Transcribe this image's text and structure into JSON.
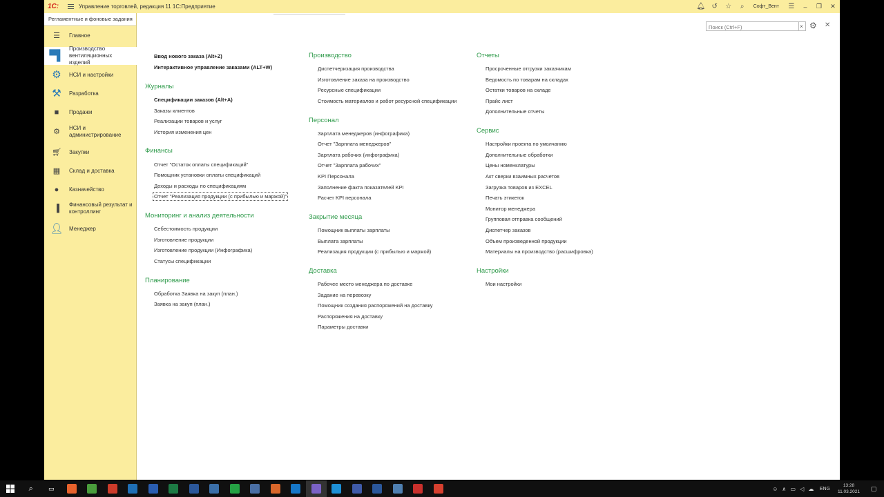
{
  "titlebar": {
    "logo": "1С:",
    "title": "Управление торговлей, редакция 11 1С:Предприятие",
    "user": "Софт_Вент"
  },
  "sidebar": {
    "bg_tasks": "Регламентные и фоновые задания",
    "items": [
      {
        "label": "Главное",
        "icon": "list-icon"
      },
      {
        "label": "Производство вентиляционных изделий",
        "icon": "factory-icon"
      },
      {
        "label": "НСИ и настройки",
        "icon": "gears-icon"
      },
      {
        "label": "Разработка",
        "icon": "development-icon"
      },
      {
        "label": "Продажи",
        "icon": "bag-icon"
      },
      {
        "label": "НСИ и администрирование",
        "icon": "gear-icon"
      },
      {
        "label": "Закупки",
        "icon": "cart-icon"
      },
      {
        "label": "Склад и доставка",
        "icon": "warehouse-icon"
      },
      {
        "label": "Казначейство",
        "icon": "coin-icon"
      },
      {
        "label": "Финансовый результат и контроллинг",
        "icon": "chart-icon"
      },
      {
        "label": "Менеджер",
        "icon": "person-icon"
      }
    ]
  },
  "search": {
    "placeholder": "Поиск (Ctrl+F)"
  },
  "col1": {
    "top_links": [
      "Ввод нового заказа (Alt+Z)",
      "Интерактивное управление заказами (ALT+W)"
    ],
    "journals": {
      "title": "Журналы",
      "links": [
        "Спецификации заказов (Alt+A)",
        "Заказы клиентов",
        "Реализации товаров и услуг",
        "История изменения цен"
      ]
    },
    "finance": {
      "title": "Финансы",
      "links": [
        "Отчет \"Остаток оплаты спецификаций\"",
        "Помощник установки оплаты спецификаций",
        "Доходы и расходы по спецификациям",
        "Отчет \"Реализация продукции (с прибылью и маржой)\""
      ]
    },
    "monitoring": {
      "title": "Мониторинг и анализ деятельности",
      "links": [
        "Себестоимость продукции",
        "Изготовление продукции",
        "Изготовление продукции (Инфографика)",
        "Статусы спецификации"
      ]
    },
    "planning": {
      "title": "Планирование",
      "links": [
        "Обработка Заявка на закуп (план.)",
        "Заявка на закуп (план.)"
      ]
    }
  },
  "col2": {
    "production": {
      "title": "Производство",
      "links": [
        "Диспетчеризация производства",
        "Изготовление заказа на производство",
        "Ресурсные спецификации",
        "Стоимость материалов и работ ресурсной спецификации"
      ]
    },
    "personnel": {
      "title": "Персонал",
      "links": [
        "Зарплата менеджеров (инфографика)",
        "Отчет \"Зарплата менеджеров\"",
        "Зарплата рабочих (инфографика)",
        "Отчет \"Зарплата рабочих\"",
        "KPI Персонала",
        "Заполнение факта показателей KPI",
        "Расчет KPI персонала"
      ]
    },
    "month_close": {
      "title": "Закрытие месяца",
      "links": [
        "Помощник выплаты зарплаты",
        "Выплата зарплаты",
        "Реализация продукции (с прибылью и маржой)"
      ]
    },
    "delivery": {
      "title": "Доставка",
      "links": [
        "Рабочее место менеджера по доставке",
        "Задание на перевозку",
        "Помощник создания распоряжений на доставку",
        "Распоряжения на доставку",
        "Параметры доставки"
      ]
    }
  },
  "col3": {
    "reports": {
      "title": "Отчеты",
      "links": [
        "Просроченные отгрузки заказчикам",
        "Ведомость по товарам на складах",
        "Остатки товаров на складе",
        "Прайс лист",
        "Дополнительные отчеты"
      ]
    },
    "service": {
      "title": "Сервис",
      "links": [
        "Настройки проекта по умолчанию",
        "Дополнительные обработки",
        "Цены номенклатуры",
        "Акт сверки взаимных расчетов",
        "Загрузка товаров из EXCEL",
        "Печать этикеток",
        "Монитор менеджера",
        "Групповая отправка сообщений",
        "Диспетчер заказов",
        "Объем произведенной продукции",
        "Материалы на производство (расшифровка)"
      ]
    },
    "settings": {
      "title": "Настройки",
      "links": [
        "Мои настройки"
      ]
    }
  },
  "taskbar": {
    "lang": "ENG",
    "time": "13:28",
    "date": "11.03.2021",
    "colors": [
      "#e8622c",
      "#4a9d3c",
      "#cc3b2a",
      "#1f6fb5",
      "#2a5db0",
      "#1d7a44",
      "#2b579a",
      "#3b6fa8",
      "#25a244",
      "#4a6fa5",
      "#d9662a",
      "#1677c8",
      "#7b62c7",
      "#1e90d6",
      "#3f5aa8",
      "#2b579a",
      "#4f7fb0",
      "#c9302c",
      "#d6402f"
    ]
  }
}
